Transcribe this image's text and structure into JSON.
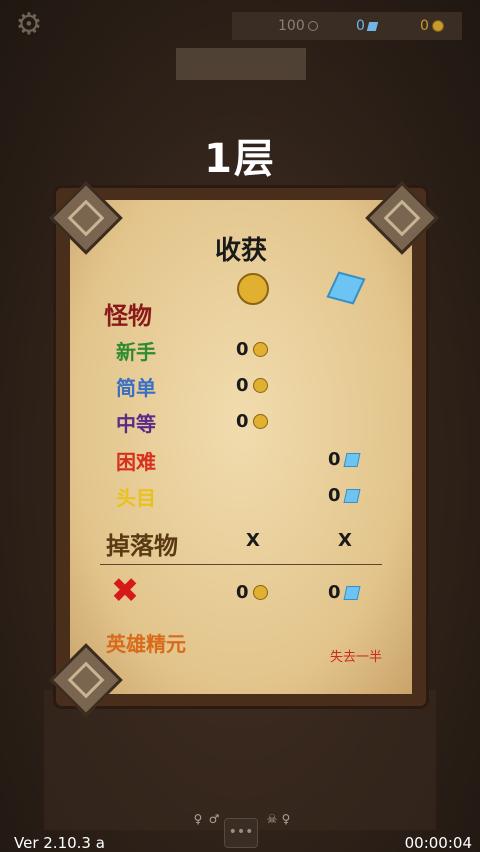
{
  "resources": {
    "clocks": "100",
    "gems": "0",
    "coins": "0"
  },
  "floor_title": "1层",
  "harvest": {
    "title": "收获",
    "monsters_label": "怪物",
    "rows": [
      {
        "label": "新手",
        "color": "#2e8b2e",
        "coins": "0",
        "gems": ""
      },
      {
        "label": "简单",
        "color": "#3a6fc4",
        "coins": "0",
        "gems": ""
      },
      {
        "label": "中等",
        "color": "#5a2a8a",
        "coins": "0",
        "gems": ""
      },
      {
        "label": "困难",
        "color": "#d8301e",
        "coins": "",
        "gems": "0"
      },
      {
        "label": "头目",
        "color": "#e8c21e",
        "coins": "",
        "gems": "0"
      }
    ],
    "drops_label": "掉落物",
    "drops_coins": "X",
    "drops_gems": "X",
    "total_coins": "0",
    "total_gems": "0",
    "hero_essence_label": "英雄精元",
    "half_lost_label": "失去一半"
  },
  "footer": {
    "version": "Ver 2.10.3 a",
    "time": "00:00:04"
  },
  "icons": {
    "settings": "gear-icon",
    "coin": "coin-icon",
    "gem": "gem-icon",
    "fail": "cross-icon",
    "menu": "menu-icon"
  }
}
